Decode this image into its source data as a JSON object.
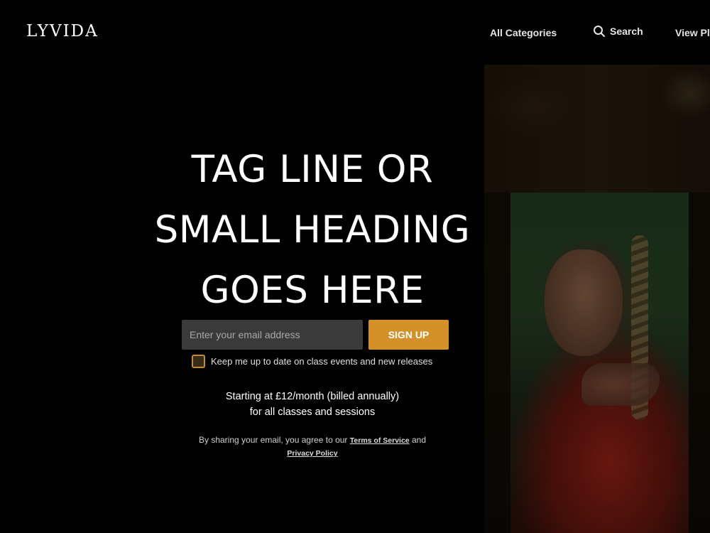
{
  "header": {
    "logo": "LYVIDA",
    "nav": {
      "categories": "All Categories",
      "search": "Search",
      "plans": "View Pl"
    }
  },
  "hero": {
    "tagline_lines": [
      "TAG LINE OR",
      "SMALL HEADING",
      "GOES HERE"
    ]
  },
  "signup": {
    "email_placeholder": "Enter your email address",
    "button_label": "SIGN UP",
    "newsletter_label": "Keep me up to date on class events and new releases",
    "newsletter_checked": false
  },
  "pricing": {
    "line1": "Starting at £12/month (billed annually)",
    "line2": "for all classes and sessions"
  },
  "legal": {
    "prefix": "By sharing your email, you agree to our",
    "terms_link": "Terms of Service",
    "conjunction": "and",
    "privacy_link": "Privacy Policy"
  },
  "colors": {
    "background": "#000000",
    "accent": "#d4912a",
    "input_bg": "#3a3a3a"
  },
  "icons": {
    "search": "search-icon"
  }
}
